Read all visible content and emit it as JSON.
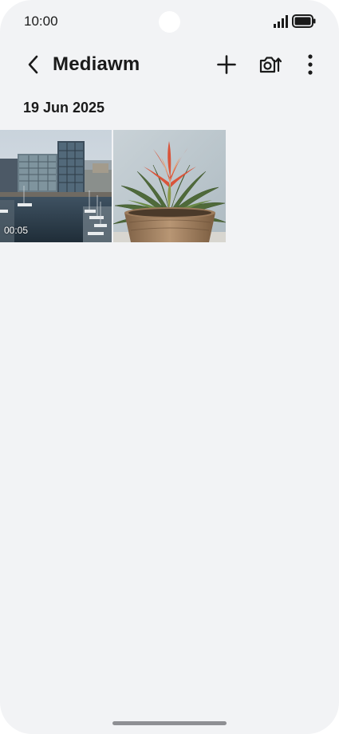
{
  "status_bar": {
    "time": "10:00"
  },
  "header": {
    "back_icon": "chevron-left-icon",
    "title": "Mediawm",
    "actions": [
      "plus-icon",
      "camera-switch-icon",
      "more-vertical-icon"
    ]
  },
  "section": {
    "date": "19 Jun 2025"
  },
  "items": [
    {
      "kind": "video",
      "duration": "00:05",
      "subject": "harbour-buildings-thumbnail"
    },
    {
      "kind": "image",
      "subject": "potted-plant-thumbnail"
    }
  ],
  "colors": {
    "background": "#f2f3f5",
    "text": "#1a1a1a",
    "home_indicator": "#8e8f93"
  }
}
